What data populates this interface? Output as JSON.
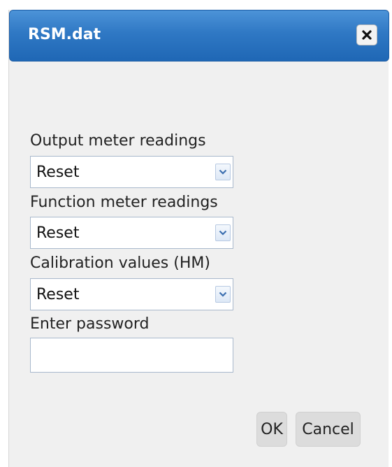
{
  "dialog": {
    "title": "RSM.dat",
    "close_icon": "close-icon"
  },
  "form": {
    "output_meter": {
      "label": "Output meter readings",
      "selected": "Reset"
    },
    "function_meter": {
      "label": "Function meter readings",
      "selected": "Reset"
    },
    "calibration": {
      "label": "Calibration values (HM)",
      "selected": "Reset"
    },
    "password": {
      "label": "Enter password",
      "value": "",
      "placeholder": ""
    }
  },
  "buttons": {
    "ok": "OK",
    "cancel": "Cancel"
  },
  "colors": {
    "titlebar": "#2f78c4",
    "dialog_bg": "#f0f0f0",
    "button_bg": "#dcdcdc"
  }
}
